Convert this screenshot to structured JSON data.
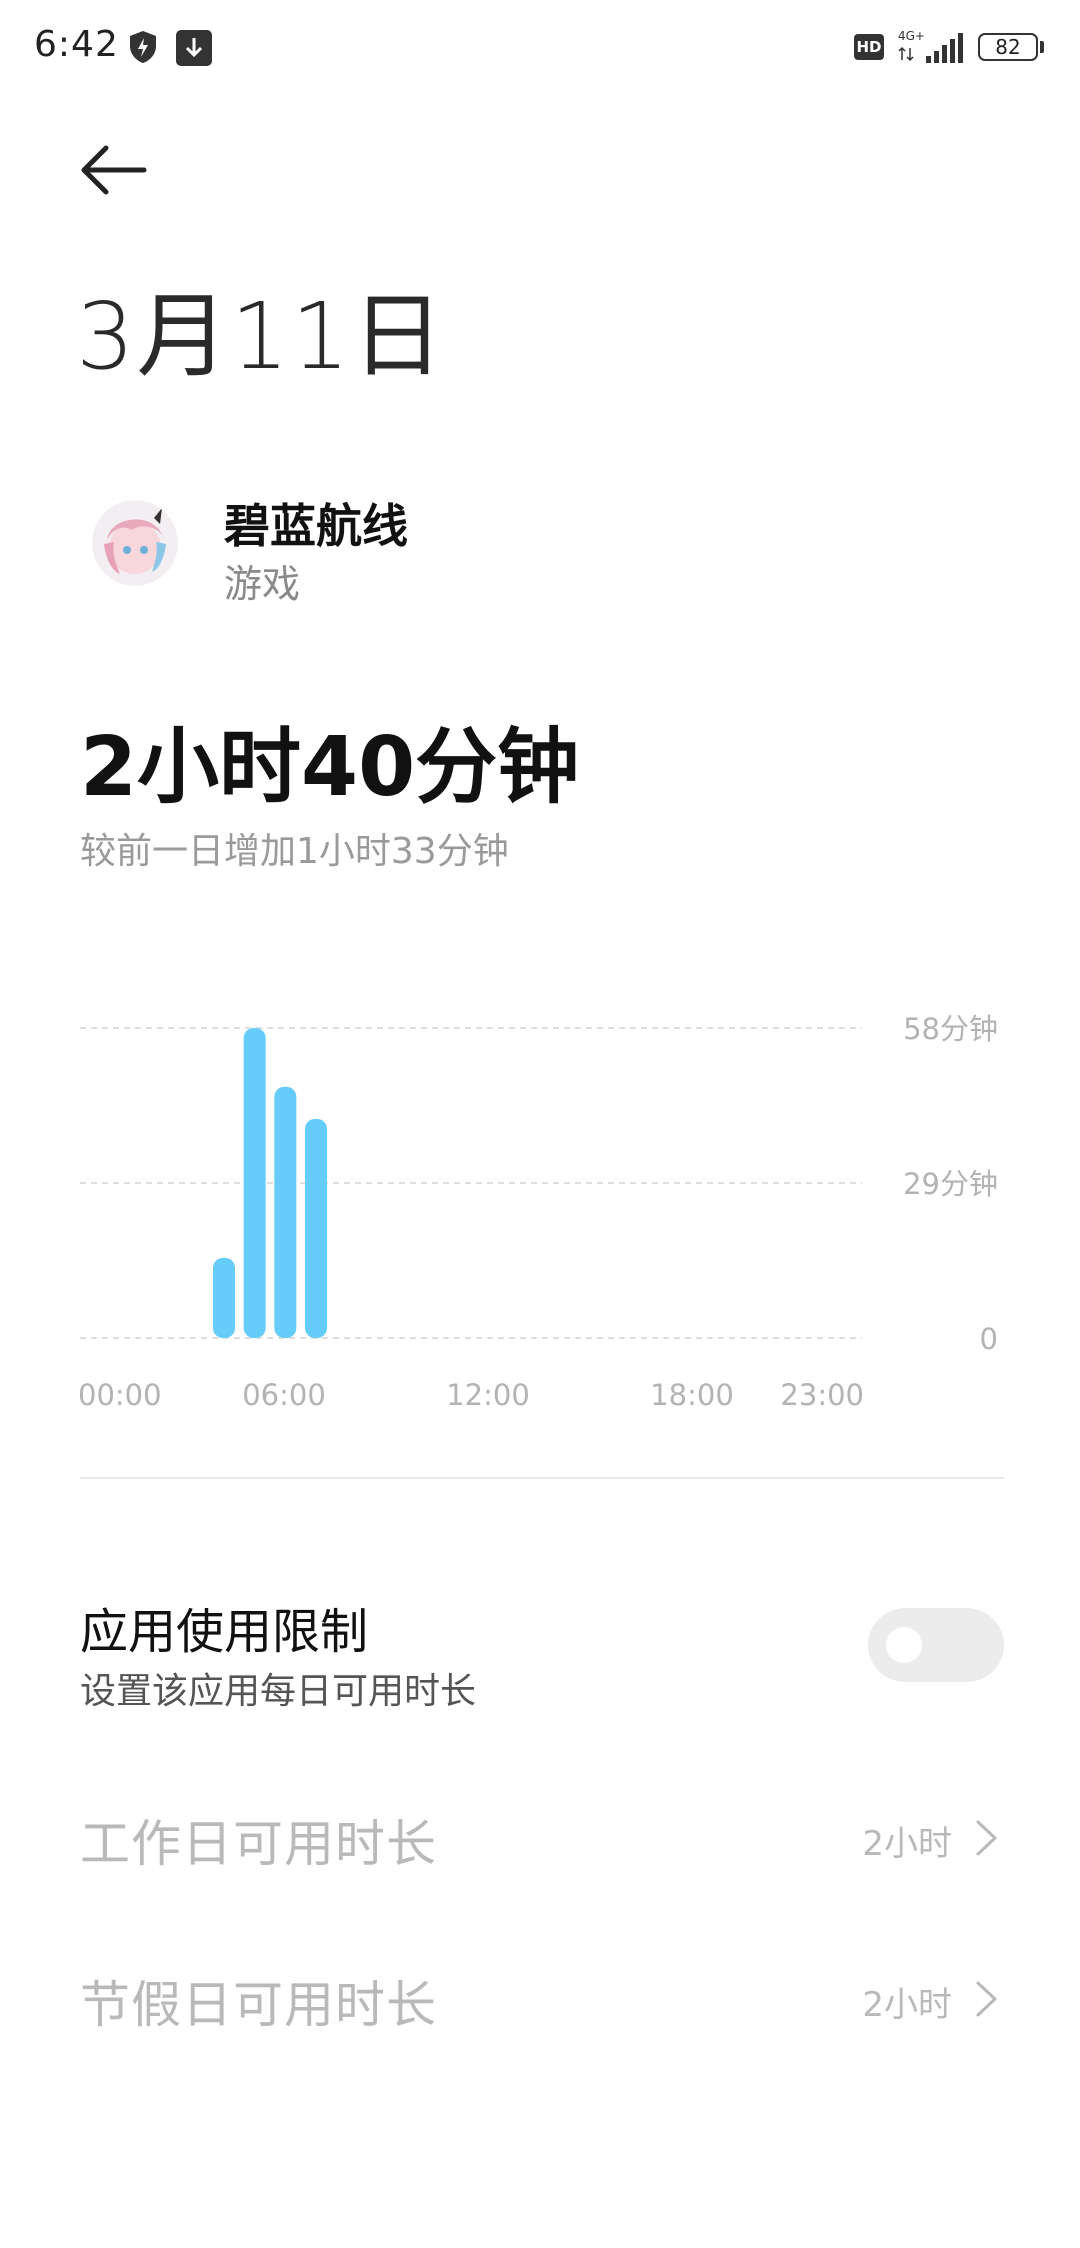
{
  "status_bar": {
    "time": "6:42",
    "hd": "HD",
    "network": "4G+",
    "battery": "82",
    "icons": [
      "shield-icon",
      "download-icon",
      "hd-icon",
      "signal-icon",
      "battery-icon"
    ]
  },
  "header": {
    "back_icon": "back-arrow-icon",
    "title": "3月11日"
  },
  "app": {
    "name": "碧蓝航线",
    "category": "游戏"
  },
  "usage": {
    "total": "2小时40分钟",
    "compare": "较前一日增加1小时33分钟"
  },
  "chart_data": {
    "type": "bar",
    "x_tick_labels": [
      "00:00",
      "06:00",
      "12:00",
      "18:00",
      "23:00"
    ],
    "y_tick_labels": [
      "58分钟",
      "29分钟",
      "0"
    ],
    "ylim": [
      0,
      58
    ],
    "hours": [
      0,
      1,
      2,
      3,
      4,
      5,
      6,
      7,
      8,
      9,
      10,
      11,
      12,
      13,
      14,
      15,
      16,
      17,
      18,
      19,
      20,
      21,
      22,
      23
    ],
    "values": [
      0,
      0,
      0,
      0,
      15,
      58,
      47,
      41,
      0,
      0,
      0,
      0,
      0,
      0,
      0,
      0,
      0,
      0,
      0,
      0,
      0,
      0,
      0,
      0
    ],
    "grid": true,
    "bar_color": "#66cdfb"
  },
  "limit": {
    "title": "应用使用限制",
    "subtitle": "设置该应用每日可用时长",
    "enabled": false
  },
  "rows": [
    {
      "label": "工作日可用时长",
      "value": "2小时"
    },
    {
      "label": "节假日可用时长",
      "value": "2小时"
    }
  ]
}
